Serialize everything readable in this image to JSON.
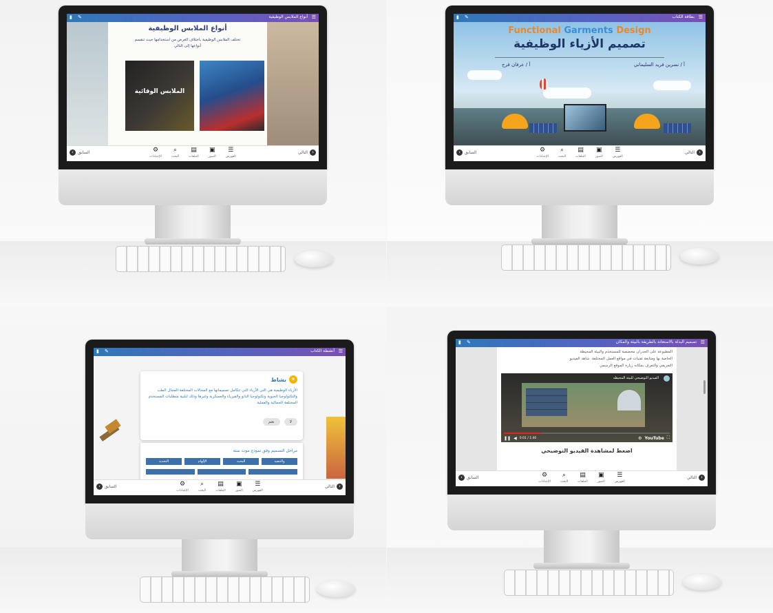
{
  "panels": {
    "tl": {
      "window_title": "أنواع الملابس الوظيفية",
      "heading": "أنواع الملابس الوظيفية",
      "intro_line1": "تختلف الملابس الوظيفية باختلاف الغرض من استخدامها حيث تنقسم",
      "intro_line2": "أنواعها إلى التالي",
      "card_label": "الملابس الوقائية"
    },
    "tr": {
      "window_title": "بطاقة الكتاب",
      "en_title_a": "Functional",
      "en_title_b": "Garments",
      "en_title_c": "Design",
      "ar_title": "تصميم الأزياء الوظيفية",
      "author_a": "أ / نسرين فريد السليماني",
      "author_b": "أ / عرفان فرج"
    },
    "bl": {
      "window_title": "أنشطة الكتاب",
      "activity_heading": "نشاط",
      "activity_text": "الأزياء الوظيفية هي التي الأزياء التي تتكامل تصميماتها مع المجالات المختلفة المجال الطب والتكنولوجيا الحيوية وتكنولوجيا النانو والفيزياء والعسكرية وغيرها وذلك لتلبية متطلبات المستخدم المختلفة الجمالية والعملية",
      "btn_yes": "نعم",
      "btn_no": "لا",
      "question": "مراحل التصميم وفق نموذج موت ستة",
      "options": [
        "والتنفيذ",
        "البحث",
        "الإلهام",
        "التحديد"
      ]
    },
    "br": {
      "window_title": "تصميم البذلة بالاستعانة بالطريقة بالبيئة والمكان",
      "para_line1": "المطبوعة على الجدران مخصصة للمستخدم والبيئة المحيطة",
      "para_line2": "الخاصة بها ومتابعة تقنيات في مواقع العمل المختلفة. شاهد الفيديو",
      "para_line3": "التعريفي والتعرف بمكانه زيارة الموقع الرسمي",
      "video_title": "الفيديو التوضيحي للبيئة المحيطة",
      "video_time": "0:01 / 1:40",
      "youtube_label": "YouTube",
      "caption": "اضغط لمشاهدة الفيديو التوضيحي"
    }
  },
  "toolbar": {
    "prev": "السابق",
    "next": "التالي",
    "items": [
      {
        "icon": "☰",
        "label": "الفهرس",
        "name": "menu-icon"
      },
      {
        "icon": "▣",
        "label": "الصور",
        "name": "gallery-icon"
      },
      {
        "icon": "▤",
        "label": "الملفات",
        "name": "files-icon"
      },
      {
        "icon": "⌕",
        "label": "البحث",
        "name": "search-icon"
      },
      {
        "icon": "⚙",
        "label": "الإعدادات",
        "name": "settings-icon"
      }
    ]
  },
  "colors": {
    "accent_blue": "#2f78b8",
    "accent_purple": "#7a4fb4",
    "title_orange": "#e8892b",
    "title_blue": "#3a8fd4",
    "heading_navy": "#34417c",
    "activity_yellow": "#f4b400"
  }
}
